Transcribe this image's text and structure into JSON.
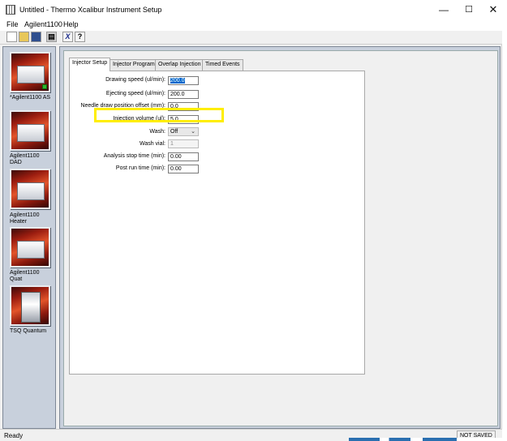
{
  "window": {
    "title": "Untitled - Thermo Xcalibur Instrument Setup"
  },
  "window_controls": {
    "minimize": "—",
    "maximize": "☐",
    "close": "✕"
  },
  "menu": {
    "items": [
      "File",
      "Agilent1100",
      "Help"
    ]
  },
  "toolbar": {
    "print_glyph": "▤",
    "cut_glyph": "X",
    "help_glyph": "?"
  },
  "instruments": [
    {
      "label": "*Agilent1100 AS",
      "status_color": "#2db72d"
    },
    {
      "label": "Agilent1100 DAD"
    },
    {
      "label": "Agilent1100 Heater"
    },
    {
      "label": "Agilent1100 Quat"
    },
    {
      "label": "TSQ Quantum"
    }
  ],
  "tabs": [
    {
      "label": "Injector Setup",
      "active": true
    },
    {
      "label": "Injector Program"
    },
    {
      "label": "Overlap Injection"
    },
    {
      "label": "Timed Events"
    }
  ],
  "form": {
    "drawing_speed": {
      "label": "Drawing speed (ul/min):",
      "value": "200.0"
    },
    "ejecting_speed": {
      "label": "Ejecting speed (ul/min):",
      "value": "200.0"
    },
    "needle_offset": {
      "label": "Needle draw position offset (mm):",
      "value": "0.0"
    },
    "injection_volume": {
      "label": "Injection volume (ul):",
      "value": "5.0"
    },
    "wash": {
      "label": "Wash:",
      "value": "Off"
    },
    "wash_vial": {
      "label": "Wash vial:",
      "value": "1"
    },
    "analysis_stop": {
      "label": "Analysis stop time (min):",
      "value": "0.00"
    },
    "post_run": {
      "label": "Post run time (min):",
      "value": "0.00"
    }
  },
  "highlight_color": "#ffee00",
  "status": {
    "left": "Ready",
    "right": "NOT SAVED"
  }
}
